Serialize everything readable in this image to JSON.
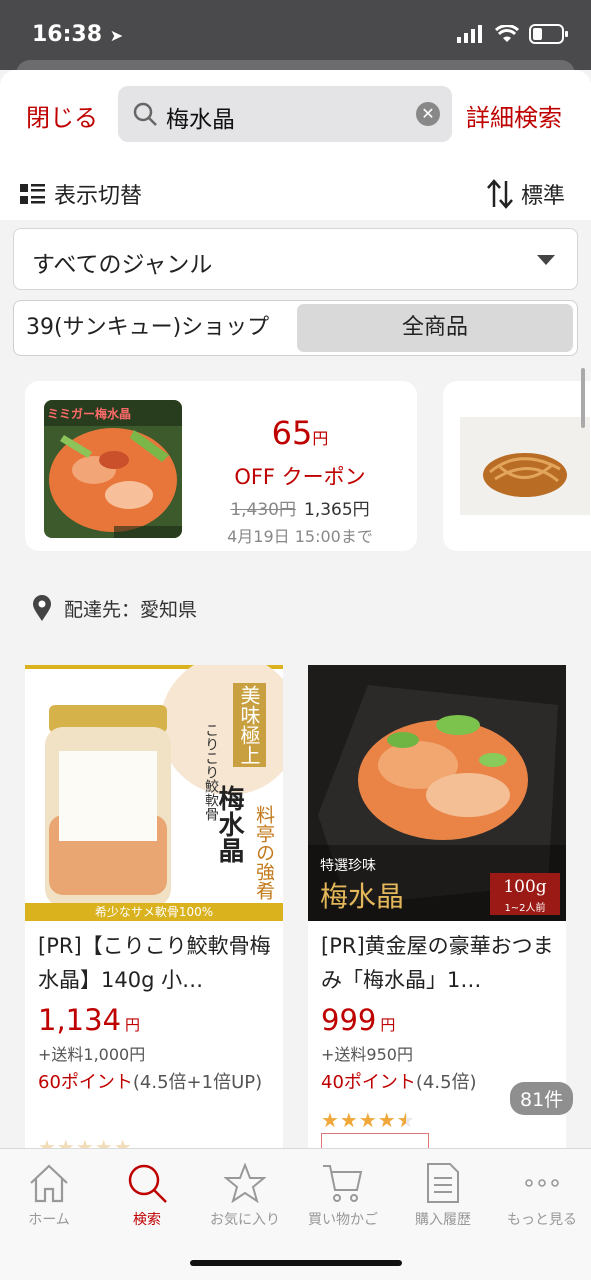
{
  "status": {
    "time": "16:38"
  },
  "header": {
    "close_label": "閉じる",
    "search_value": "梅水晶",
    "detail_label": "詳細検索",
    "view_toggle_label": "表示切替",
    "sort_label": "標準"
  },
  "genre": {
    "selected": "すべてのジャンル"
  },
  "shop_filter": {
    "option_left": "39(サンキュー)ショップ",
    "option_right": "全商品",
    "selected": "全商品"
  },
  "coupon": {
    "amount": "65",
    "yen": "円",
    "off_label": "OFF クーポン",
    "original_price": "1,430円",
    "discounted_price": "1,365円",
    "until": "4月19日 15:00まで",
    "thumb_caption": "ミミガー梅水晶"
  },
  "delivery": {
    "label": "配達先：愛知県"
  },
  "products": [
    {
      "title": "[PR]【こりこり鮫軟骨梅水晶】140g 小…",
      "price": "1,134",
      "yen": "円",
      "shipping": "+送料1,000円",
      "points": "60ポイント",
      "points_note": "(4.5倍+1倍UP)",
      "img_banner": "希少なサメ軟骨100%",
      "img_text_main": "梅水晶",
      "img_text_sub": "料亭の強肴",
      "img_text_top": "美味極上",
      "img_label_small": "こりこり鮫軟骨"
    },
    {
      "title": "[PR]黄金屋の豪華おつまみ「梅水晶」1…",
      "price": "999",
      "yen": "円",
      "shipping": "+送料950円",
      "points": "40ポイント",
      "points_note": "(4.5倍)",
      "rating": 4.5,
      "img_label_top": "特選珍味",
      "img_label_main": "梅水晶",
      "img_weight": "100g",
      "img_weight_sub": "1~2人前"
    }
  ],
  "result_count": "81件",
  "tabs": [
    {
      "label": "ホーム",
      "icon": "home-icon"
    },
    {
      "label": "検索",
      "icon": "search-icon"
    },
    {
      "label": "お気に入り",
      "icon": "star-icon"
    },
    {
      "label": "買い物かご",
      "icon": "cart-icon"
    },
    {
      "label": "購入履歴",
      "icon": "receipt-icon"
    },
    {
      "label": "もっと見る",
      "icon": "more-icon"
    }
  ],
  "colors": {
    "accent": "#bf0000",
    "star": "#f0a83b"
  }
}
